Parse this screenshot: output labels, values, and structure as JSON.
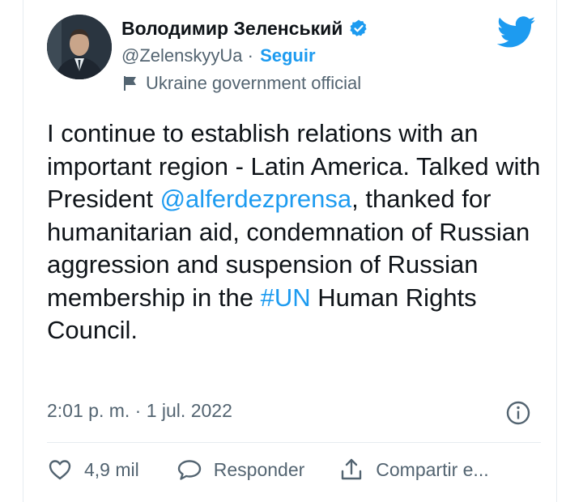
{
  "author": {
    "name": "Володимир Зеленський",
    "handle": "@ZelenskyyUa",
    "separator": " · ",
    "follow_label": "Seguir",
    "account_label": "Ukraine government official"
  },
  "tweet": {
    "text_part1": "I continue to establish relations with an important region - Latin America. Talked with President ",
    "mention": "@alferdezprensa",
    "text_part2": ", thanked for humanitarian aid, condemnation of Russian aggression and suspension of Russian membership in the ",
    "hashtag": "#UN",
    "text_part3": " Human Rights Council."
  },
  "meta": {
    "timestamp": "2:01 p. m. · 1 jul. 2022"
  },
  "actions": {
    "likes_count": "4,9 mil",
    "reply_label": "Responder",
    "share_label": "Compartir e..."
  },
  "colors": {
    "accent": "#1d9bf0",
    "text": "#0f1419",
    "secondary": "#536471"
  },
  "icons": {
    "verified": "verified-badge-icon",
    "label": "flag-icon",
    "logo": "twitter-bird-icon",
    "info": "info-icon",
    "like": "heart-icon",
    "reply": "reply-bubble-icon",
    "share": "share-icon"
  }
}
